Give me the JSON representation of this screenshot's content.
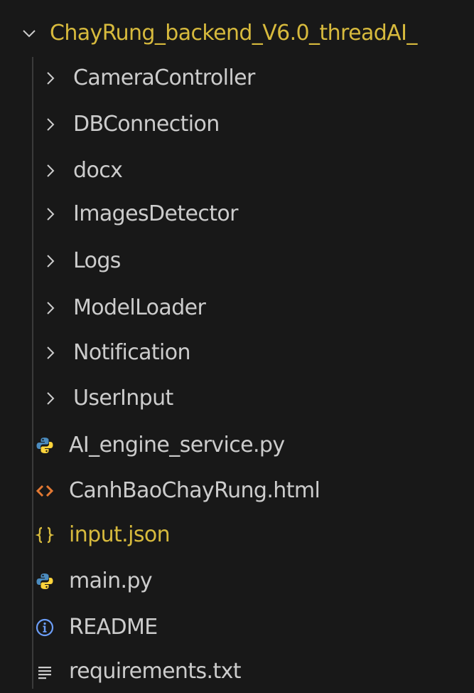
{
  "explorer": {
    "root": {
      "label": "ChayRung_backend_V6.0_threadAI_",
      "expanded": true,
      "color": "#d7ba3d"
    },
    "folders": [
      {
        "label": "CameraController"
      },
      {
        "label": "DBConnection"
      },
      {
        "label": "docx"
      },
      {
        "label": "ImagesDetector"
      },
      {
        "label": "Logs"
      },
      {
        "label": "ModelLoader"
      },
      {
        "label": "Notification"
      },
      {
        "label": "UserInput"
      }
    ],
    "files": [
      {
        "label": "AI_engine_service.py",
        "icon": "python-icon"
      },
      {
        "label": "CanhBaoChayRung.html",
        "icon": "html-icon"
      },
      {
        "label": "input.json",
        "icon": "json-icon"
      },
      {
        "label": "main.py",
        "icon": "python-icon"
      },
      {
        "label": "README",
        "icon": "info-icon"
      },
      {
        "label": "requirements.txt",
        "icon": "text-file-icon"
      }
    ]
  },
  "colors": {
    "background": "#181818",
    "text": "#cccccc",
    "accent_yellow": "#d7ba3d",
    "python_blue": "#4b8bbe",
    "python_yellow": "#ffd43b",
    "html_orange": "#e37933",
    "info_blue": "#6c9ef8"
  }
}
